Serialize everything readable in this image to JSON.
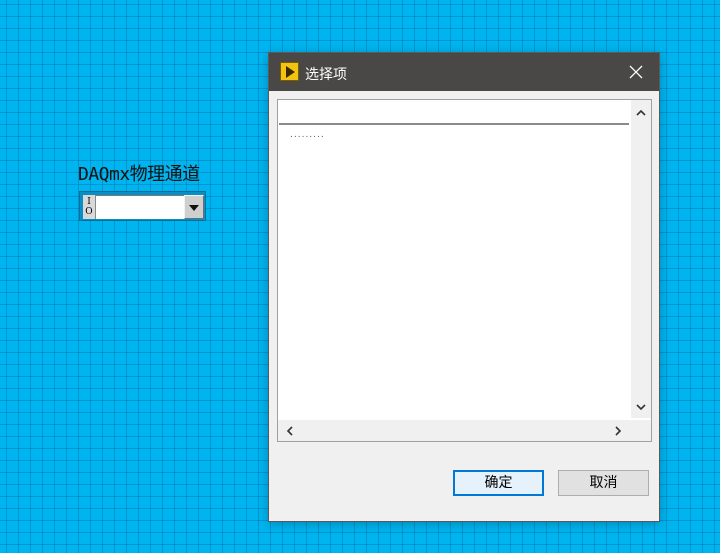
{
  "front_panel": {
    "control_label": "DAQmx物理通道",
    "io_tag": [
      "I",
      "O"
    ],
    "control_value": ""
  },
  "dialog": {
    "title": "选择项",
    "list_items": [
      "........."
    ],
    "ok_label": "确定",
    "cancel_label": "取消"
  },
  "icons": {
    "app": "labview-app-icon",
    "close": "close-icon",
    "dropdown": "chevron-down-icon",
    "scroll_up": "chevron-up-icon",
    "scroll_down": "chevron-down-icon",
    "scroll_left": "chevron-left-icon",
    "scroll_right": "chevron-right-icon"
  },
  "colors": {
    "panel_background": "#00b4ef",
    "titlebar": "#4a4747",
    "default_button_border": "#0078d7"
  }
}
